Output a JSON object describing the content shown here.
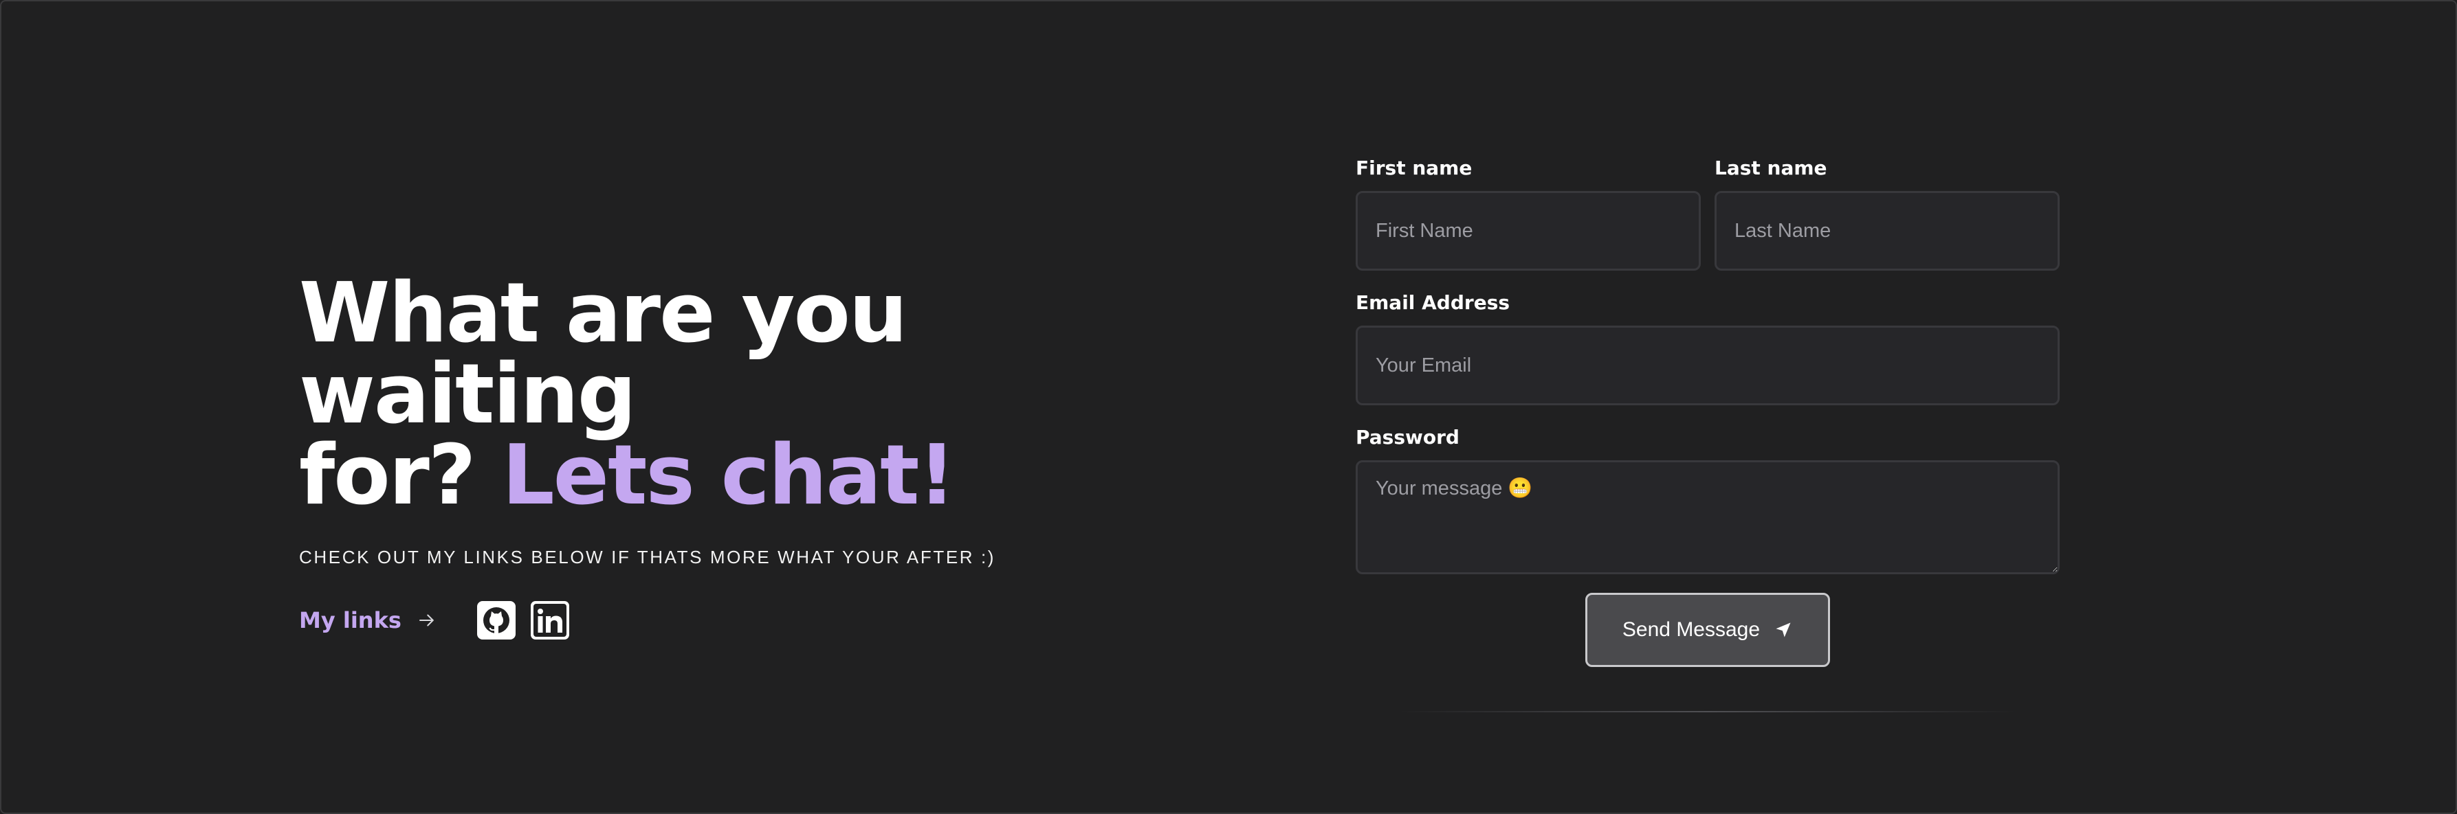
{
  "hero": {
    "heading_line1": "What are you waiting",
    "heading_line2_plain": "for? ",
    "heading_line2_accent": "Lets chat!",
    "subtext": "CHECK OUT MY LINKS BELOW IF THATS MORE WHAT YOUR AFTER :)",
    "links_label": "My links"
  },
  "social": {
    "icons": [
      "github-icon",
      "linkedin-icon"
    ]
  },
  "form": {
    "first_name": {
      "label": "First name",
      "placeholder": "First Name"
    },
    "last_name": {
      "label": "Last name",
      "placeholder": "Last Name"
    },
    "email": {
      "label": "Email Address",
      "placeholder": "Your Email"
    },
    "password": {
      "label": "Password",
      "placeholder": "Your message 😬"
    },
    "send_label": "Send Message"
  },
  "colors": {
    "background": "#202021",
    "accent": "#c4a7f0",
    "input_bg": "#262629",
    "button_bg": "#4a4a4d"
  }
}
